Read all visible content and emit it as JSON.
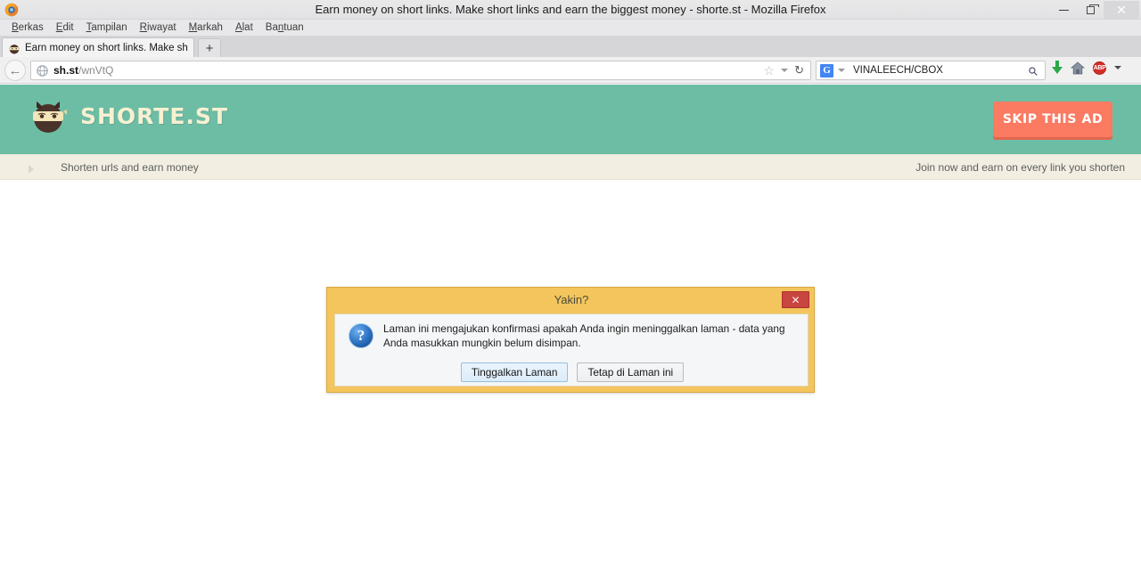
{
  "window": {
    "title": "Earn money on short links. Make short links and earn the biggest money - shorte.st - Mozilla Firefox",
    "controls": {
      "minimize": "minimize-button",
      "restore": "restore-button",
      "close": "close-button"
    }
  },
  "menubar": {
    "items": [
      {
        "label": "Berkas",
        "accel": "B"
      },
      {
        "label": "Edit",
        "accel": "E"
      },
      {
        "label": "Tampilan",
        "accel": "T"
      },
      {
        "label": "Riwayat",
        "accel": "R"
      },
      {
        "label": "Markah",
        "accel": "M"
      },
      {
        "label": "Alat",
        "accel": "A"
      },
      {
        "label": "Bantuan",
        "accel": "n"
      }
    ]
  },
  "tabs": {
    "active": {
      "label": "Earn money on short links. Make short li..."
    },
    "new_tab_label": "+"
  },
  "navbar": {
    "back_label": "←",
    "url_domain": "sh.st",
    "url_path": "/wnVtQ",
    "star_label": "☆",
    "reload_label": "↻",
    "search_engine": "G",
    "search_value": "VINALEECH/CBOX",
    "search_submit_label": "⚲",
    "home_label": "⌂",
    "adblock_label": "ABP"
  },
  "page": {
    "brand": "SHORTE.ST",
    "skip_button": "SKIP THIS AD",
    "subbar_left": "Shorten urls and earn money",
    "subbar_right": "Join now and earn on every link you shorten",
    "colors": {
      "header_green": "#6dbda5",
      "skip_orange": "#fa7a62",
      "subbar_beige": "#f2efe2",
      "wordmark_cream": "#f7f0d2"
    }
  },
  "dialog": {
    "title": "Yakin?",
    "close_label": "✕",
    "icon": "question-icon",
    "message": "Laman ini mengajukan konfirmasi apakah Anda ingin meninggalkan laman - data yang Anda masukkan mungkin belum disimpan.",
    "buttons": {
      "leave": "Tinggalkan Laman",
      "stay": "Tetap di Laman ini"
    },
    "colors": {
      "chrome": "#f3c55c",
      "close_red": "#c9453f"
    }
  }
}
